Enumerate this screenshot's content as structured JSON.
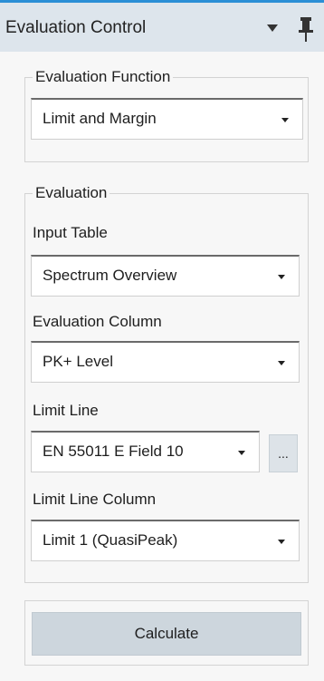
{
  "header": {
    "title": "Evaluation Control",
    "dropdown_icon": "triangle-down-icon",
    "pin_icon": "pin-icon"
  },
  "colors": {
    "accent": "#2b8fd6",
    "header_bg": "#dde5ec",
    "button_bg": "#cdd6dd"
  },
  "evaluation_function": {
    "legend": "Evaluation Function",
    "selected": "Limit and Margin"
  },
  "evaluation": {
    "legend": "Evaluation",
    "input_table_label": "Input Table",
    "input_table_value": "Spectrum Overview",
    "evaluation_column_label": "Evaluation Column",
    "evaluation_column_value": "PK+ Level",
    "limit_line_label": "Limit Line",
    "limit_line_value": "EN 55011 E Field 10",
    "limit_line_browse": "...",
    "limit_line_column_label": "Limit Line Column",
    "limit_line_column_value": "Limit 1 (QuasiPeak)"
  },
  "actions": {
    "calculate_label": "Calculate"
  }
}
